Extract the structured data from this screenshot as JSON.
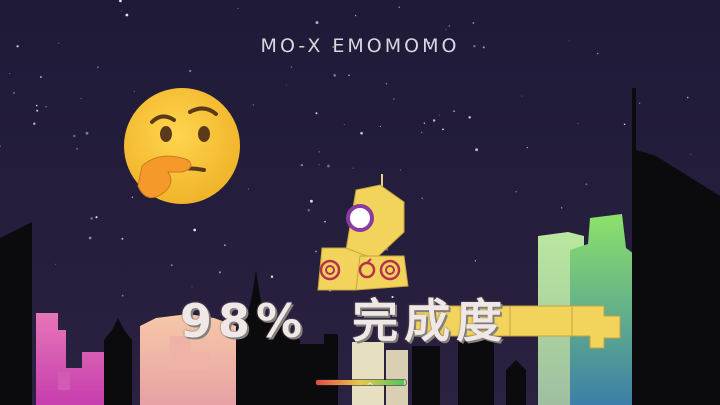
{
  "level": {
    "title": "MO-X EMOMOMO"
  },
  "progress": {
    "percent_text": "98%",
    "label": "完成度",
    "value": 0.98
  },
  "hint_emoji": {
    "icon": "thinking-face-icon"
  },
  "meter": {
    "fill": 0.98,
    "colors": [
      "#e34a4a",
      "#e9c84a",
      "#4bc85a"
    ],
    "toggle_icon": "chevron-up-icon"
  },
  "colors": {
    "sky_top": "#221d3d",
    "sky_bottom": "#2c2240",
    "block_yellow": "#f2d35b",
    "emoji_yellow": "#f5c33b",
    "swirl": "#b8324e",
    "ring_purple": "#8a3aa0"
  }
}
